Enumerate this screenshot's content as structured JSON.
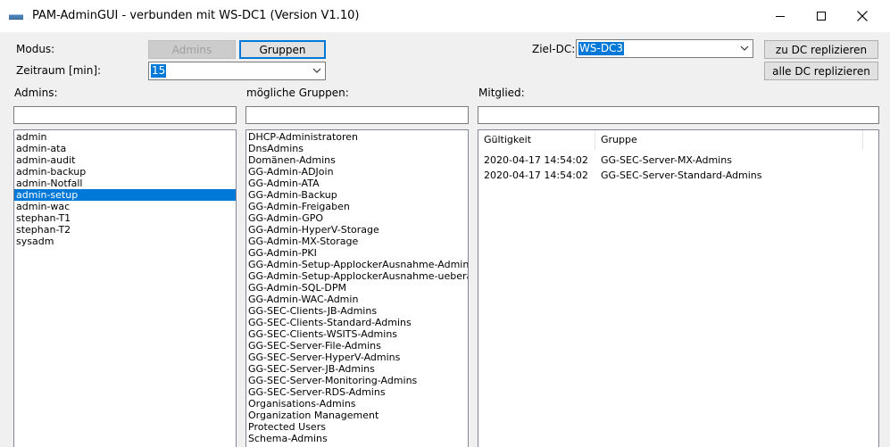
{
  "window": {
    "title": "PAM-AdminGUI - verbunden mit WS-DC1 (Version V1.10)"
  },
  "modus": {
    "label": "Modus:",
    "admins_button": "Admins",
    "gruppen_button": "Gruppen"
  },
  "zeitraum": {
    "label": "Zeitraum [min]:",
    "value": "15"
  },
  "ziel_dc": {
    "label": "Ziel-DC:",
    "value": "WS-DC3"
  },
  "buttons": {
    "zu_dc": "zu DC replizieren",
    "alle_dc": "alle DC replizieren"
  },
  "admins": {
    "label": "Admins:",
    "filter": "",
    "selected_index": 5,
    "items": [
      "admin",
      "admin-ata",
      "admin-audit",
      "admin-backup",
      "admin-Notfall",
      "admin-setup",
      "admin-wac",
      "stephan-T1",
      "stephan-T2",
      "sysadm"
    ]
  },
  "groups": {
    "label": "mögliche Gruppen:",
    "filter": "",
    "items": [
      "DHCP-Administratoren",
      "DnsAdmins",
      "Domänen-Admins",
      "GG-Admin-ADJoin",
      "GG-Admin-ATA",
      "GG-Admin-Backup",
      "GG-Admin-Freigaben",
      "GG-Admin-GPO",
      "GG-Admin-HyperV-Storage",
      "GG-Admin-MX-Storage",
      "GG-Admin-PKI",
      "GG-Admin-Setup-ApplockerAusnahme-AdminDir",
      "GG-Admin-Setup-ApplockerAusnahme-ueberall",
      "GG-Admin-SQL-DPM",
      "GG-Admin-WAC-Admin",
      "GG-SEC-Clients-JB-Admins",
      "GG-SEC-Clients-Standard-Admins",
      "GG-SEC-Clients-WSITS-Admins",
      "GG-SEC-Server-File-Admins",
      "GG-SEC-Server-HyperV-Admins",
      "GG-SEC-Server-JB-Admins",
      "GG-SEC-Server-Monitoring-Admins",
      "GG-SEC-Server-RDS-Admins",
      "Organisations-Admins",
      "Organization Management",
      "Protected Users",
      "Schema-Admins"
    ]
  },
  "mitglied": {
    "label": "Mitglied:",
    "filter": "",
    "columns": [
      "Gültigkeit",
      "Gruppe"
    ],
    "rows": [
      [
        "2020-04-17 14:54:02",
        "GG-SEC-Server-MX-Admins"
      ],
      [
        "2020-04-17 14:54:02",
        "GG-SEC-Server-Standard-Admins"
      ]
    ]
  }
}
